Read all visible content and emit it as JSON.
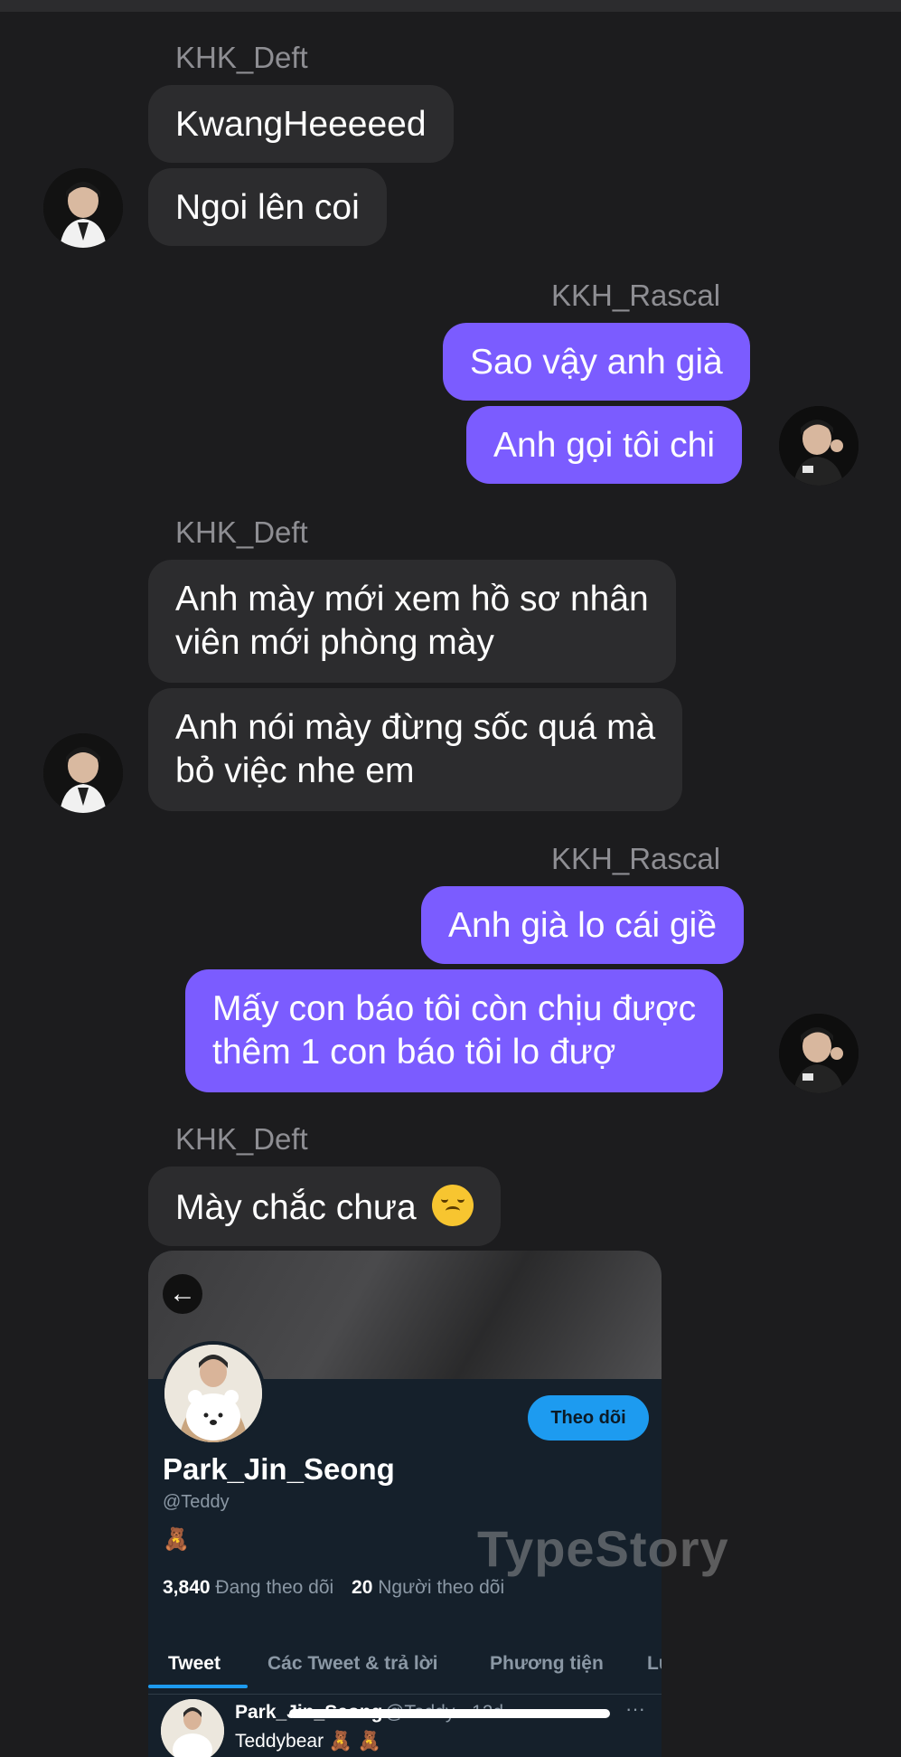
{
  "colors": {
    "background": "#1c1c1e",
    "incoming_bubble": "#2c2c2e",
    "outgoing_bubble": "#7b5cff",
    "sender_name": "#8e8e93",
    "follow_button": "#1d9bf0"
  },
  "chat": {
    "groups": [
      {
        "sender": "KHK_Deft",
        "direction": "incoming",
        "messages": [
          "KwangHeeeeed",
          "Ngoi lên coi"
        ]
      },
      {
        "sender": "KKH_Rascal",
        "direction": "outgoing",
        "messages": [
          "Sao vậy anh già",
          "Anh gọi tôi chi"
        ]
      },
      {
        "sender": "KHK_Deft",
        "direction": "incoming",
        "messages": [
          [
            "Anh mày mới xem hồ sơ nhân",
            "viên mới phòng mày"
          ],
          [
            "Anh nói mày đừng sốc quá mà",
            "bỏ việc nhe em"
          ]
        ]
      },
      {
        "sender": "KKH_Rascal",
        "direction": "outgoing",
        "messages": [
          "Anh già lo cái giề",
          [
            "Mấy con báo tôi còn chịu được",
            "thêm 1 con báo tôi lo đượ"
          ]
        ]
      },
      {
        "sender": "KHK_Deft",
        "direction": "incoming",
        "messages": [
          "Mày chắc chưa"
        ],
        "emoji": "upside-down-face-icon"
      }
    ]
  },
  "profile_card": {
    "follow_label": "Theo dõi",
    "name": "Park_Jin_Seong",
    "handle": "@Teddy",
    "bio": "🧸",
    "following_count": "3,840",
    "following_label": "Đang theo dõi",
    "followers_count": "20",
    "followers_label": "Người theo dõi",
    "tabs": [
      "Tweet",
      "Các Tweet & trả lời",
      "Phương tiện",
      "Lư"
    ],
    "active_tab": "Tweet",
    "tweet": {
      "user": "Park_Jin_Seong",
      "meta": "@Teddy · 12d",
      "text": "Teddybear 🧸 🧸"
    }
  },
  "watermark": "TypeStory"
}
